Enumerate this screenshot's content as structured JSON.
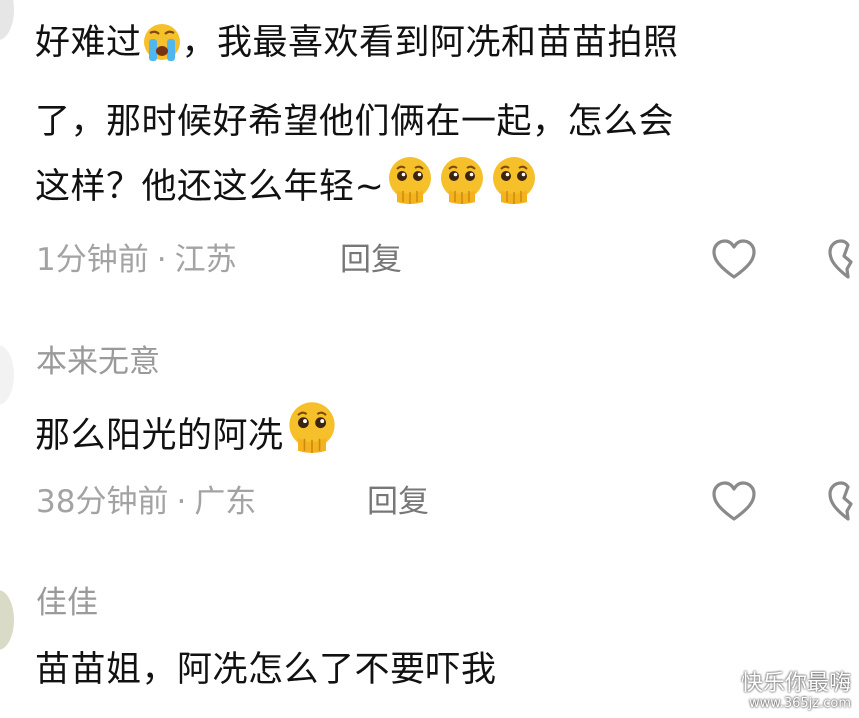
{
  "comments": [
    {
      "lines": [
        "好难过",
        "，我最喜欢看到阿冼和苗苗拍照",
        "了，那时候好希望他们俩在一起，怎么会",
        "这样？他还这么年轻~"
      ],
      "time": "1分钟前",
      "location": "江苏",
      "reply_label": "回复"
    },
    {
      "username": "本来无意",
      "text": "那么阳光的阿冼",
      "time": "38分钟前",
      "location": "广东",
      "reply_label": "回复"
    },
    {
      "username": "佳佳",
      "text": "苗苗姐，阿冼怎么了不要吓我"
    }
  ],
  "meta_separator": "·",
  "watermark": {
    "line1": "快乐你最嗨",
    "line2": "www.365jz.com"
  },
  "icons": {
    "like": "heart-outline-icon",
    "dislike": "broken-heart-icon",
    "emoji_crying": "loudly-crying-emoji",
    "emoji_pleading": "pleading-face-emoji"
  },
  "colors": {
    "text": "#111111",
    "meta": "#a3a3a3",
    "icon": "#8a8a8a",
    "emoji": "#f6c02a"
  }
}
